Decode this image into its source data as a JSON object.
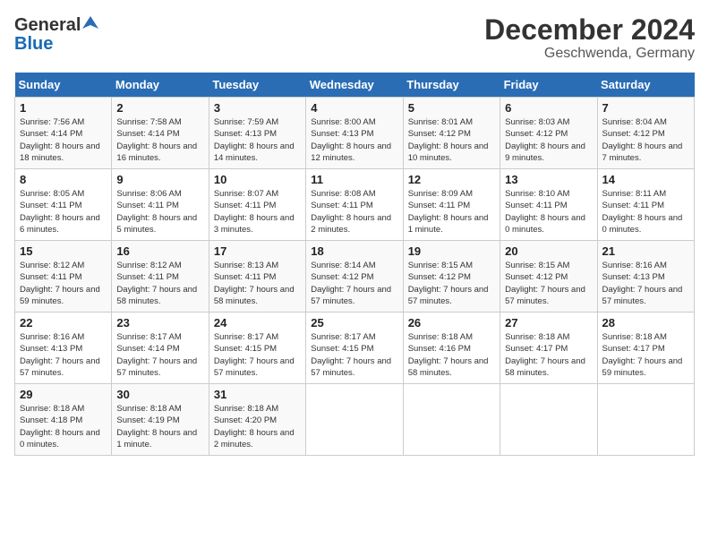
{
  "header": {
    "logo_general": "General",
    "logo_blue": "Blue",
    "title": "December 2024",
    "location": "Geschwenda, Germany"
  },
  "days_of_week": [
    "Sunday",
    "Monday",
    "Tuesday",
    "Wednesday",
    "Thursday",
    "Friday",
    "Saturday"
  ],
  "weeks": [
    [
      {
        "day": "1",
        "sunrise": "Sunrise: 7:56 AM",
        "sunset": "Sunset: 4:14 PM",
        "daylight": "Daylight: 8 hours and 18 minutes."
      },
      {
        "day": "2",
        "sunrise": "Sunrise: 7:58 AM",
        "sunset": "Sunset: 4:14 PM",
        "daylight": "Daylight: 8 hours and 16 minutes."
      },
      {
        "day": "3",
        "sunrise": "Sunrise: 7:59 AM",
        "sunset": "Sunset: 4:13 PM",
        "daylight": "Daylight: 8 hours and 14 minutes."
      },
      {
        "day": "4",
        "sunrise": "Sunrise: 8:00 AM",
        "sunset": "Sunset: 4:13 PM",
        "daylight": "Daylight: 8 hours and 12 minutes."
      },
      {
        "day": "5",
        "sunrise": "Sunrise: 8:01 AM",
        "sunset": "Sunset: 4:12 PM",
        "daylight": "Daylight: 8 hours and 10 minutes."
      },
      {
        "day": "6",
        "sunrise": "Sunrise: 8:03 AM",
        "sunset": "Sunset: 4:12 PM",
        "daylight": "Daylight: 8 hours and 9 minutes."
      },
      {
        "day": "7",
        "sunrise": "Sunrise: 8:04 AM",
        "sunset": "Sunset: 4:12 PM",
        "daylight": "Daylight: 8 hours and 7 minutes."
      }
    ],
    [
      {
        "day": "8",
        "sunrise": "Sunrise: 8:05 AM",
        "sunset": "Sunset: 4:11 PM",
        "daylight": "Daylight: 8 hours and 6 minutes."
      },
      {
        "day": "9",
        "sunrise": "Sunrise: 8:06 AM",
        "sunset": "Sunset: 4:11 PM",
        "daylight": "Daylight: 8 hours and 5 minutes."
      },
      {
        "day": "10",
        "sunrise": "Sunrise: 8:07 AM",
        "sunset": "Sunset: 4:11 PM",
        "daylight": "Daylight: 8 hours and 3 minutes."
      },
      {
        "day": "11",
        "sunrise": "Sunrise: 8:08 AM",
        "sunset": "Sunset: 4:11 PM",
        "daylight": "Daylight: 8 hours and 2 minutes."
      },
      {
        "day": "12",
        "sunrise": "Sunrise: 8:09 AM",
        "sunset": "Sunset: 4:11 PM",
        "daylight": "Daylight: 8 hours and 1 minute."
      },
      {
        "day": "13",
        "sunrise": "Sunrise: 8:10 AM",
        "sunset": "Sunset: 4:11 PM",
        "daylight": "Daylight: 8 hours and 0 minutes."
      },
      {
        "day": "14",
        "sunrise": "Sunrise: 8:11 AM",
        "sunset": "Sunset: 4:11 PM",
        "daylight": "Daylight: 8 hours and 0 minutes."
      }
    ],
    [
      {
        "day": "15",
        "sunrise": "Sunrise: 8:12 AM",
        "sunset": "Sunset: 4:11 PM",
        "daylight": "Daylight: 7 hours and 59 minutes."
      },
      {
        "day": "16",
        "sunrise": "Sunrise: 8:12 AM",
        "sunset": "Sunset: 4:11 PM",
        "daylight": "Daylight: 7 hours and 58 minutes."
      },
      {
        "day": "17",
        "sunrise": "Sunrise: 8:13 AM",
        "sunset": "Sunset: 4:11 PM",
        "daylight": "Daylight: 7 hours and 58 minutes."
      },
      {
        "day": "18",
        "sunrise": "Sunrise: 8:14 AM",
        "sunset": "Sunset: 4:12 PM",
        "daylight": "Daylight: 7 hours and 57 minutes."
      },
      {
        "day": "19",
        "sunrise": "Sunrise: 8:15 AM",
        "sunset": "Sunset: 4:12 PM",
        "daylight": "Daylight: 7 hours and 57 minutes."
      },
      {
        "day": "20",
        "sunrise": "Sunrise: 8:15 AM",
        "sunset": "Sunset: 4:12 PM",
        "daylight": "Daylight: 7 hours and 57 minutes."
      },
      {
        "day": "21",
        "sunrise": "Sunrise: 8:16 AM",
        "sunset": "Sunset: 4:13 PM",
        "daylight": "Daylight: 7 hours and 57 minutes."
      }
    ],
    [
      {
        "day": "22",
        "sunrise": "Sunrise: 8:16 AM",
        "sunset": "Sunset: 4:13 PM",
        "daylight": "Daylight: 7 hours and 57 minutes."
      },
      {
        "day": "23",
        "sunrise": "Sunrise: 8:17 AM",
        "sunset": "Sunset: 4:14 PM",
        "daylight": "Daylight: 7 hours and 57 minutes."
      },
      {
        "day": "24",
        "sunrise": "Sunrise: 8:17 AM",
        "sunset": "Sunset: 4:15 PM",
        "daylight": "Daylight: 7 hours and 57 minutes."
      },
      {
        "day": "25",
        "sunrise": "Sunrise: 8:17 AM",
        "sunset": "Sunset: 4:15 PM",
        "daylight": "Daylight: 7 hours and 57 minutes."
      },
      {
        "day": "26",
        "sunrise": "Sunrise: 8:18 AM",
        "sunset": "Sunset: 4:16 PM",
        "daylight": "Daylight: 7 hours and 58 minutes."
      },
      {
        "day": "27",
        "sunrise": "Sunrise: 8:18 AM",
        "sunset": "Sunset: 4:17 PM",
        "daylight": "Daylight: 7 hours and 58 minutes."
      },
      {
        "day": "28",
        "sunrise": "Sunrise: 8:18 AM",
        "sunset": "Sunset: 4:17 PM",
        "daylight": "Daylight: 7 hours and 59 minutes."
      }
    ],
    [
      {
        "day": "29",
        "sunrise": "Sunrise: 8:18 AM",
        "sunset": "Sunset: 4:18 PM",
        "daylight": "Daylight: 8 hours and 0 minutes."
      },
      {
        "day": "30",
        "sunrise": "Sunrise: 8:18 AM",
        "sunset": "Sunset: 4:19 PM",
        "daylight": "Daylight: 8 hours and 1 minute."
      },
      {
        "day": "31",
        "sunrise": "Sunrise: 8:18 AM",
        "sunset": "Sunset: 4:20 PM",
        "daylight": "Daylight: 8 hours and 2 minutes."
      },
      null,
      null,
      null,
      null
    ]
  ]
}
